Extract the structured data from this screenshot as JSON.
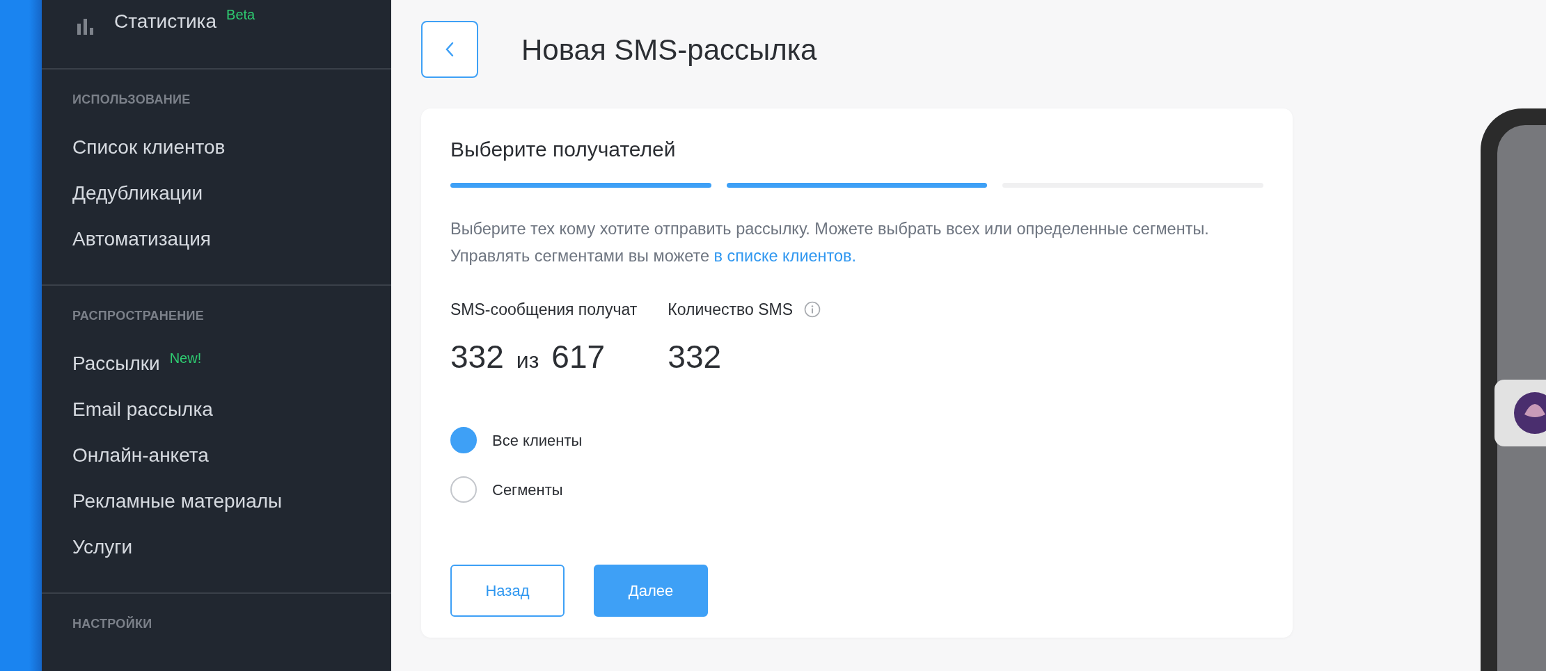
{
  "sidebar": {
    "top_item": {
      "label": "Статистика",
      "badge": "Beta"
    },
    "sections": [
      {
        "title": "ИСПОЛЬЗОВАНИЕ",
        "items": [
          {
            "label": "Список клиентов"
          },
          {
            "label": "Дедубликации"
          },
          {
            "label": "Автоматизация"
          }
        ]
      },
      {
        "title": "РАСПРОСТРАНЕНИЕ",
        "items": [
          {
            "label": "Рассылки",
            "badge": "New!"
          },
          {
            "label": "Email рассылка"
          },
          {
            "label": "Онлайн-анкета"
          },
          {
            "label": "Рекламные материалы"
          },
          {
            "label": "Услуги"
          }
        ]
      },
      {
        "title": "НАСТРОЙКИ"
      }
    ]
  },
  "page": {
    "title": "Новая SMS-рассылка"
  },
  "card": {
    "heading": "Выберите получателей",
    "steps": [
      {
        "done": true
      },
      {
        "done": true
      },
      {
        "done": false
      }
    ],
    "description": "Выберите тех кому хотите отправить рассылку. Можете выбрать всех или определенные сегменты. Управлять сегментами вы можете ",
    "description_link": "в списке клиентов.",
    "recipients": {
      "label": "SMS-сообщения получат",
      "count": "332",
      "separator": "из",
      "total": "617"
    },
    "sms_count": {
      "label": "Количество SMS",
      "value": "332"
    },
    "options": [
      {
        "label": "Все клиенты",
        "selected": true
      },
      {
        "label": "Сегменты",
        "selected": false
      }
    ],
    "buttons": [
      {
        "label": "Назад",
        "kind": "outline"
      },
      {
        "label": "Далее",
        "kind": "primary"
      }
    ]
  }
}
